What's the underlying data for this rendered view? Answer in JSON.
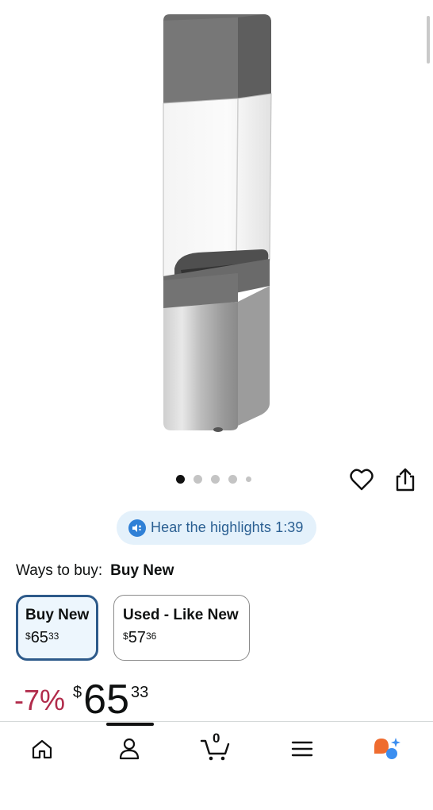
{
  "product": {
    "image_alt": "Stainless steel and clear cylindrical dispenser product image",
    "image_dots_total": 5,
    "image_dots_active": 1
  },
  "highlights": {
    "label": "Hear the highlights 1:39"
  },
  "ways_to_buy": {
    "label": "Ways to buy:",
    "selected": "Buy New"
  },
  "options": [
    {
      "title": "Buy New",
      "currency": "$",
      "whole": "65",
      "fraction": "33",
      "selected": true
    },
    {
      "title": "Used - Like New",
      "currency": "$",
      "whole": "57",
      "fraction": "36",
      "selected": false
    }
  ],
  "price": {
    "discount": "-7%",
    "currency": "$",
    "whole": "65",
    "fraction": "33"
  },
  "nav": {
    "cart_count": "0",
    "items": [
      "home-icon",
      "account-icon",
      "cart-icon",
      "menu-icon",
      "rufus-icon"
    ]
  },
  "colors": {
    "selected_border": "#2d5a8a",
    "selected_bg": "#edf6fd",
    "discount": "#b12b4b",
    "pill_bg": "#e4f1fb",
    "pill_text": "#2a5f92",
    "rufus_orange": "#ef6c2f",
    "rufus_blue": "#3b8ef0"
  }
}
